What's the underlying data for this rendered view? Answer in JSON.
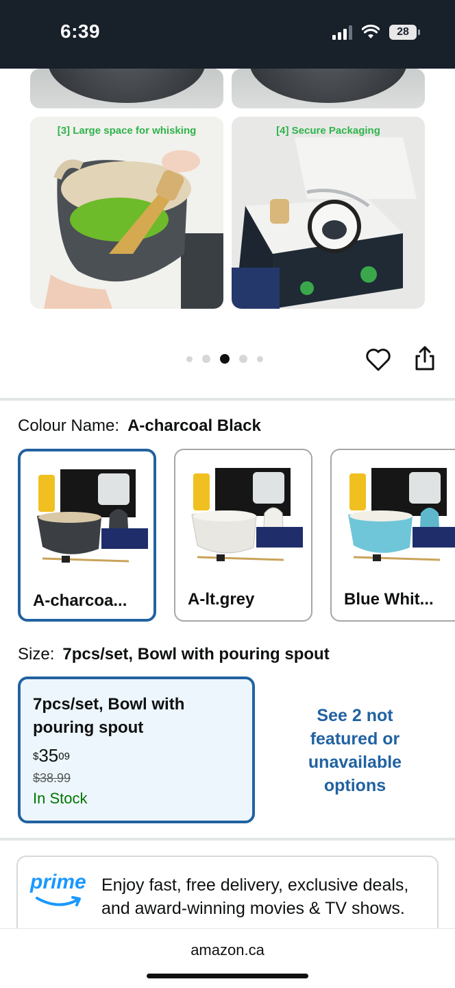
{
  "status_bar": {
    "time": "6:39",
    "battery": "28"
  },
  "gallery": {
    "captions": [
      "[3] Large space for whisking",
      "[4] Secure Packaging"
    ],
    "dots_count": 5,
    "active_dot_index": 2
  },
  "colour": {
    "label": "Colour Name:",
    "value": "A-charcoal Black",
    "options": [
      {
        "label": "A-charcoa...",
        "selected": true,
        "bowl_color": "#3b3f44"
      },
      {
        "label": "A-lt.grey",
        "selected": false,
        "bowl_color": "#e9e7e1"
      },
      {
        "label": "Blue Whit...",
        "selected": false,
        "bowl_color": "#6fc6d8"
      }
    ]
  },
  "size": {
    "label": "Size:",
    "value": "7pcs/set, Bowl with pouring spout",
    "option": {
      "title": "7pcs/set, Bowl with pouring spout",
      "price_currency": "$",
      "price_whole": "35",
      "price_fraction": "09",
      "price_old": "$38.99",
      "stock": "In Stock"
    },
    "see_more": "See 2 not featured or unavailable options"
  },
  "prime": {
    "logo": "prime",
    "text": "Enjoy fast, free delivery, exclusive deals, and award-winning movies & TV shows."
  },
  "bottom": {
    "domain": "amazon.ca"
  },
  "colors": {
    "accent_blue": "#2162a1",
    "stock_green": "#007600",
    "prime_blue": "#1a98ff",
    "caption_green": "#2fb34a"
  }
}
